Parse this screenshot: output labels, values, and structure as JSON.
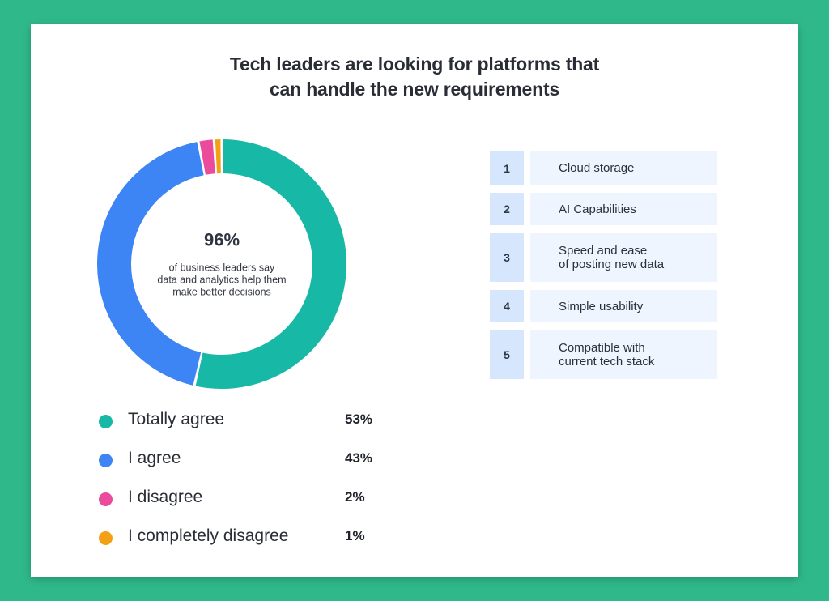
{
  "title": {
    "line1": "Tech leaders are looking for platforms that",
    "line2": "can handle the new requirements"
  },
  "center": {
    "value": "96%",
    "caption": "of business leaders say data and analytics help them make better decisions",
    "caption_lines": [
      "of business leaders say",
      "data and analytics help them",
      "make better decisions"
    ]
  },
  "chart_data": {
    "type": "pie",
    "subtype": "donut",
    "title": "Tech leaders are looking for platforms that can handle the new requirements",
    "start": "top",
    "direction": "clockwise",
    "categories": [
      "Totally agree",
      "I agree",
      "I disagree",
      "I completely disagree"
    ],
    "values": [
      53,
      43,
      2,
      1
    ],
    "value_labels": [
      "53%",
      "43%",
      "2%",
      "1%"
    ],
    "colors": [
      "#17b8a5",
      "#3d84f5",
      "#ea4b9d",
      "#f4a014"
    ],
    "legend_position": "bottom-left",
    "center_label": "96%"
  },
  "legend": [
    {
      "label": "Totally agree",
      "value": "53%",
      "color": "#17b8a5"
    },
    {
      "label": "I agree",
      "value": "43%",
      "color": "#3d84f5"
    },
    {
      "label": "I disagree",
      "value": "2%",
      "color": "#ea4b9d"
    },
    {
      "label": "I completely disagree",
      "value": "1%",
      "color": "#f4a014"
    }
  ],
  "requirements": [
    {
      "rank": "1",
      "text": "Cloud storage"
    },
    {
      "rank": "2",
      "text": "AI Capabilities"
    },
    {
      "rank": "3",
      "text": "Speed and ease\nof posting new data"
    },
    {
      "rank": "4",
      "text": "Simple usability"
    },
    {
      "rank": "5",
      "text": "Compatible with\ncurrent tech stack"
    }
  ]
}
